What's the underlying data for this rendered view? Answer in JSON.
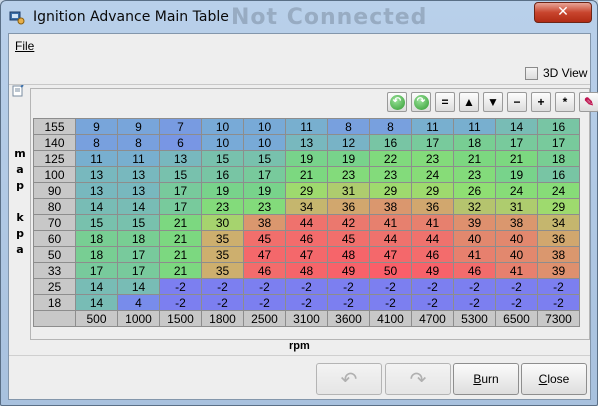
{
  "window": {
    "title": "Ignition Advance Main Table",
    "ghost_title": "Not Connected",
    "close_glyph": "✕"
  },
  "menu": {
    "file": "File"
  },
  "view3d": {
    "label": "3D View",
    "checked": false
  },
  "toolbar": {
    "buttons": [
      {
        "name": "rotate-left-icon",
        "glyph": "↶"
      },
      {
        "name": "rotate-right-icon",
        "glyph": "↷"
      },
      {
        "name": "equals-icon",
        "glyph": "="
      },
      {
        "name": "arrow-up-icon",
        "glyph": "▲"
      },
      {
        "name": "arrow-down-icon",
        "glyph": "▼"
      },
      {
        "name": "minus-icon",
        "glyph": "−"
      },
      {
        "name": "plus-icon",
        "glyph": "+"
      },
      {
        "name": "multiply-icon",
        "glyph": "*"
      },
      {
        "name": "pencil-icon",
        "glyph": "✎"
      }
    ]
  },
  "axes": {
    "y_label": "map kpa",
    "x_label": "rpm",
    "y_values": [
      "155",
      "140",
      "125",
      "100",
      "90",
      "80",
      "70",
      "60",
      "50",
      "33",
      "25",
      "18"
    ],
    "x_values": [
      "500",
      "1000",
      "1500",
      "1800",
      "2500",
      "3100",
      "3600",
      "4100",
      "4700",
      "5300",
      "6500",
      "7300"
    ]
  },
  "table": {
    "rows": [
      [
        "9",
        "9",
        "7",
        "10",
        "10",
        "11",
        "8",
        "8",
        "11",
        "11",
        "14",
        "16"
      ],
      [
        "8",
        "8",
        "6",
        "10",
        "10",
        "13",
        "12",
        "16",
        "17",
        "18",
        "17",
        "17"
      ],
      [
        "11",
        "11",
        "13",
        "15",
        "15",
        "19",
        "19",
        "22",
        "23",
        "21",
        "21",
        "18"
      ],
      [
        "13",
        "13",
        "15",
        "16",
        "17",
        "21",
        "23",
        "23",
        "24",
        "23",
        "19",
        "16"
      ],
      [
        "13",
        "13",
        "17",
        "19",
        "19",
        "29",
        "31",
        "29",
        "29",
        "26",
        "24",
        "24"
      ],
      [
        "14",
        "14",
        "17",
        "23",
        "23",
        "34",
        "36",
        "38",
        "36",
        "32",
        "31",
        "29"
      ],
      [
        "15",
        "15",
        "21",
        "30",
        "38",
        "44",
        "42",
        "41",
        "41",
        "39",
        "38",
        "34"
      ],
      [
        "18",
        "18",
        "21",
        "35",
        "45",
        "46",
        "45",
        "44",
        "44",
        "40",
        "40",
        "36"
      ],
      [
        "18",
        "17",
        "21",
        "35",
        "47",
        "47",
        "48",
        "47",
        "46",
        "41",
        "40",
        "38"
      ],
      [
        "17",
        "17",
        "21",
        "35",
        "46",
        "48",
        "49",
        "50",
        "49",
        "46",
        "41",
        "39"
      ],
      [
        "14",
        "14",
        "-2",
        "-2",
        "-2",
        "-2",
        "-2",
        "-2",
        "-2",
        "-2",
        "-2",
        "-2"
      ],
      [
        "14",
        "4",
        "-2",
        "-2",
        "-2",
        "-2",
        "-2",
        "-2",
        "-2",
        "-2",
        "-2",
        "-2"
      ]
    ]
  },
  "buttons": {
    "undo_glyph": "↶",
    "redo_glyph": "↷",
    "burn_pre": "",
    "burn_ul": "B",
    "burn_post": "urn",
    "close_pre": "",
    "close_ul": "C",
    "close_post": "lose"
  }
}
